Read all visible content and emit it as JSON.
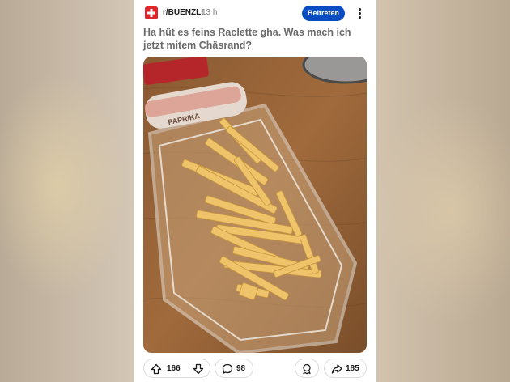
{
  "post": {
    "subreddit": "r/BUENZLI",
    "time_ago": "13 h",
    "join_label": "Beitreten",
    "title": "Ha hüt es feins Raclette gha. Was mach ich jetzt mitem Chäsrand?",
    "image_packaging_text": "PAPRIKA"
  },
  "actions": {
    "upvotes": "166",
    "comments": "98",
    "shares": "185"
  },
  "colors": {
    "join_button": "#0a4cc2",
    "subreddit_icon": "#e0242a"
  },
  "icons": {
    "subreddit": "swiss-flag-icon",
    "more": "more-vertical-icon",
    "upvote": "arrow-up-icon",
    "downvote": "arrow-down-icon",
    "comments": "comment-bubble-icon",
    "award": "award-icon",
    "share": "share-arrow-icon"
  }
}
